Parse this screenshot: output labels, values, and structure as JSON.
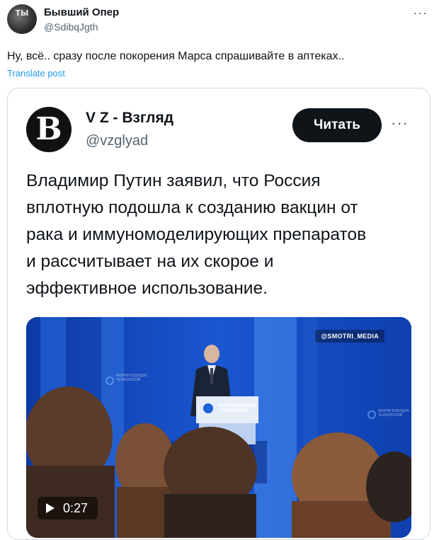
{
  "post": {
    "author_name": "Бывший Опер",
    "author_handle": "@SdibqJgth",
    "avatar_text": "ТЫ",
    "text": "Ну, всё.. сразу после покорения Марса спрашивайте в аптеках..",
    "translate_label": "Translate post",
    "more_label": "···"
  },
  "quote": {
    "avatar_letter": "B",
    "author_name": "V Z - Взгляд",
    "author_handle": "@vzglyad",
    "read_button": "Читать",
    "more_label": "···",
    "lines": [
      "Владимир Путин заявил, что Россия",
      "вплотную подошла к созданию вакцин от",
      "рака и иммуномоделирующих препаратов",
      "и рассчитывает на их скорое и",
      "эффективное использование."
    ],
    "video": {
      "watermark": "@SMOTRI_MEDIA",
      "podium_text": "ФОРУМ БУДУЩИХ ТЕХНОЛОГИЙ",
      "side_text": "ФОРУМ БУДУЩИХ ТЕХНОЛОГИЙ",
      "duration": "0:27"
    }
  },
  "colors": {
    "accent_link": "#1d9bf0",
    "button_bg": "#0f1419",
    "video_blue": "#1144b6"
  },
  "icons": {
    "more": "more-horizontal-icon",
    "play": "play-icon"
  }
}
